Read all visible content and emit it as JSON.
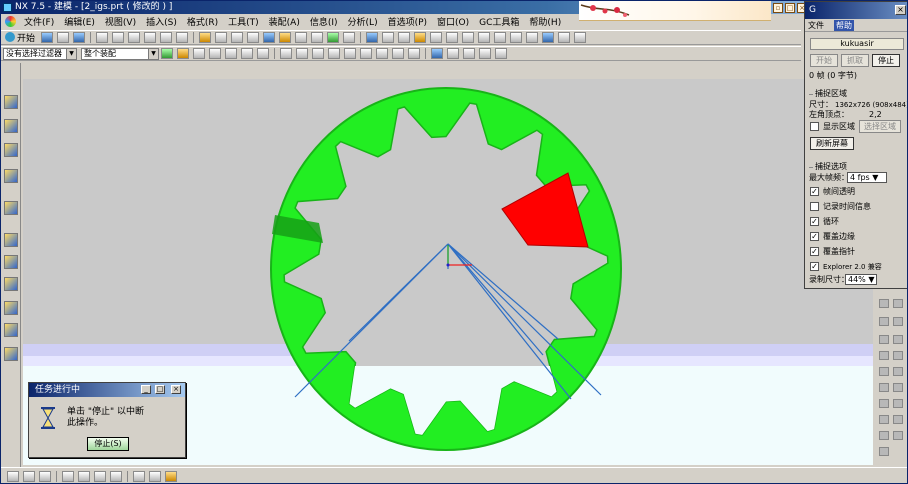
{
  "window": {
    "title": "NX 7.5 - 建模 - [2_igs.prt  ( 修改的 ) ]"
  },
  "menu": {
    "items": [
      "文件(F)",
      "编辑(E)",
      "视图(V)",
      "插入(S)",
      "格式(R)",
      "工具(T)",
      "装配(A)",
      "信息(I)",
      "分析(L)",
      "首选项(P)",
      "窗口(O)",
      "GC工具箱",
      "帮助(H)"
    ]
  },
  "toolbar": {
    "start_label": "开始",
    "selection_filter": "没有选择过滤器",
    "assembly_scope": "整个装配"
  },
  "progress_dialog": {
    "title": "任务进行中",
    "message_line1": "单击 \"停止\" 以中断",
    "message_line2": "此操作。",
    "stop_button": "停止(S)"
  },
  "capture_tool": {
    "title": "G",
    "menu_file": "文件",
    "menu_help": "帮助",
    "name": "kukuasir",
    "btn_start": "开始",
    "btn_pause": "抓取",
    "btn_stop": "停止",
    "status": "0 帧 (0 字节)",
    "capture_area_label": "捕捉区域",
    "size_label": "尺寸：",
    "size_value": "1362x726 (908x484)",
    "top_left_label": "左角顶点：",
    "top_left_value": "2,2",
    "show_area_label": "显示区域",
    "select_area_btn": "选择区域",
    "refresh_btn": "刷新屏幕",
    "capture_options_label": "捕捉选项",
    "max_fps_label": "最大帧频：",
    "max_fps_value": "4 fps",
    "opt_frame_transparent": "帧间透明",
    "opt_record_time": "记录时间信息",
    "opt_loop": "循环",
    "opt_cover_border": "覆盖边缘",
    "opt_cover_pointer": "覆盖指针",
    "opt_explorer": "Explorer 2.0 兼容",
    "record_size_label": "录制尺寸：",
    "record_size_value": "44%"
  },
  "colors": {
    "gear_fill": "#22ee22",
    "gear_shade": "#18b418",
    "highlight_face": "#ff0000",
    "axis_lines": "#2f6fc4",
    "viewport_bg": "#c9c9c9"
  },
  "icons": [
    "nx-logo-icon",
    "hourglass-icon",
    "close-icon",
    "minimize-icon",
    "maximize-icon",
    "dropdown-arrow-icon"
  ]
}
